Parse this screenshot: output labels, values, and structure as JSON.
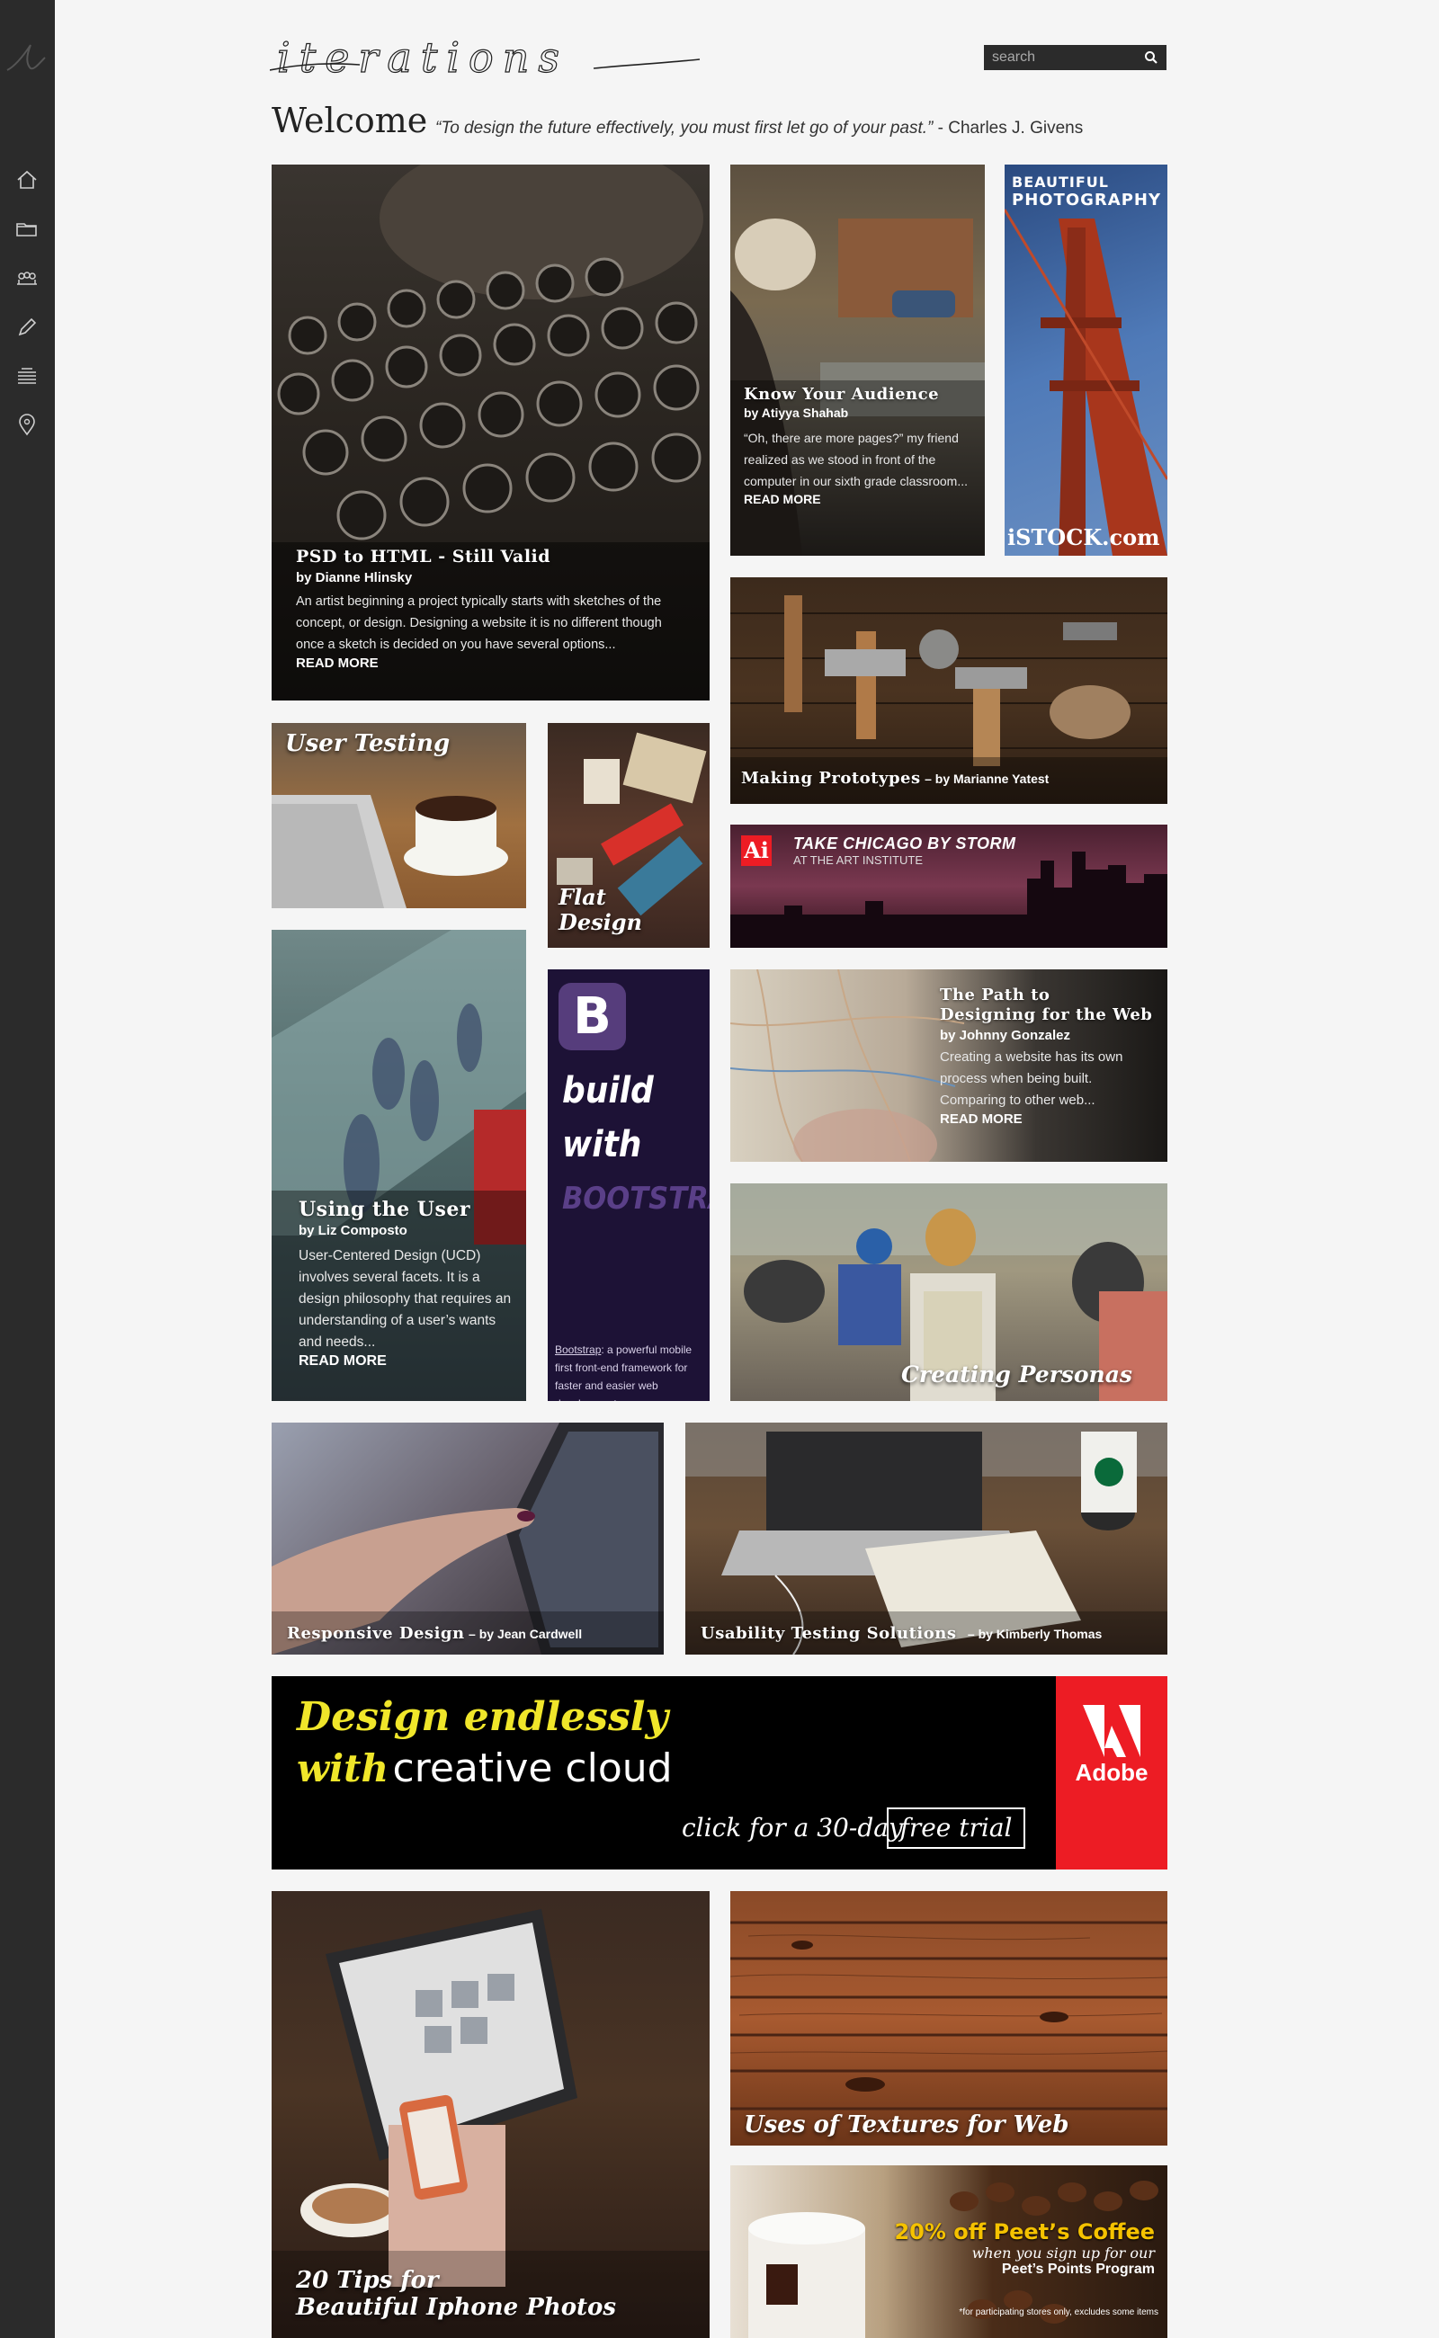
{
  "brand": {
    "logo_text": "iterations"
  },
  "search": {
    "placeholder": "search"
  },
  "welcome": {
    "heading": "Welcome",
    "quote": "“To design the future effectively, you must first let go of your past.”",
    "author": "- Charles J. Givens"
  },
  "nav": [
    {
      "icon": "home-icon"
    },
    {
      "icon": "folder-icon"
    },
    {
      "icon": "people-icon"
    },
    {
      "icon": "pencil-icon"
    },
    {
      "icon": "layers-icon"
    },
    {
      "icon": "location-pin-icon"
    }
  ],
  "tiles": {
    "psd": {
      "title": "PSD to HTML - Still  Valid",
      "by": "by Dianne Hlinsky",
      "excerpt": "An artist beginning a project typically starts with sketches of the concept, or design. Designing a website it is no different though once a sketch is decided on you have several options...",
      "more": "READ MORE"
    },
    "audience": {
      "title": "Know Your Audience",
      "by": "by Atiyya Shahab",
      "excerpt": "“Oh, there are more pages?” my friend realized as we stood in front of the computer in our sixth grade classroom...",
      "more": "READ MORE"
    },
    "istock": {
      "line1": "BEAUTIFUL",
      "line2": "PHOTOGRAPHY",
      "brand": "iSTOCK.com"
    },
    "prototypes": {
      "title": "Making Prototypes",
      "by": "– by Marianne Yatest"
    },
    "user_testing": {
      "title": "User Testing"
    },
    "flat": {
      "line1": "Flat",
      "line2": "Design"
    },
    "chicago": {
      "logo": "Ai",
      "line1": "TAKE CHICAGO BY STORM",
      "line2": "AT THE ART INSTITUTE"
    },
    "using_user": {
      "title": "Using the User",
      "by": "by Liz Composto",
      "excerpt": "User-Centered Design (UCD) involves several facets. It is a design philosophy that requires an understanding of a user’s wants and needs...",
      "more": "READ MORE"
    },
    "bootstrap": {
      "logo": "B",
      "line1": "build",
      "line2": "with",
      "line3": "BOOTSTRAP",
      "link": "Bootstrap",
      "desc": ": a powerful mobile first front-end framework for faster and easier web development"
    },
    "path": {
      "title1": "The Path to",
      "title2": "Designing for the Web",
      "by": "by Johnny Gonzalez",
      "excerpt": "Creating a website has its own process when being built. Comparing to other web...",
      "more": "READ MORE"
    },
    "personas": {
      "title": "Creating Personas"
    },
    "responsive": {
      "title": "Responsive Design",
      "by": "– by Jean Cardwell"
    },
    "usability": {
      "title": "Usability Testing Solutions",
      "by": "– by Kimberly Thomas"
    },
    "adobe": {
      "line1": "Design endlessly",
      "with": "with",
      "cc": "creative cloud",
      "click": "click for a 30-day",
      "trial": "free trial",
      "brand": "Adobe"
    },
    "iphone": {
      "line1": "20 Tips for",
      "line2": "Beautiful Iphone Photos"
    },
    "textures": {
      "title": "Uses of Textures for Web"
    },
    "peets": {
      "headline": "20% off Peet’s Coffee",
      "sub": "when you sign up for our",
      "program": "Peet’s Points Program",
      "fine": "*for participating stores only, excludes some items"
    }
  },
  "colors": {
    "sidebar": "#2b2b2b",
    "page": "#f5f5f5",
    "adobe_red": "#ed1c24",
    "adobe_yellow": "#f0e62a",
    "peets_yellow": "#f5c200",
    "bootstrap_bg": "#1d1236"
  }
}
